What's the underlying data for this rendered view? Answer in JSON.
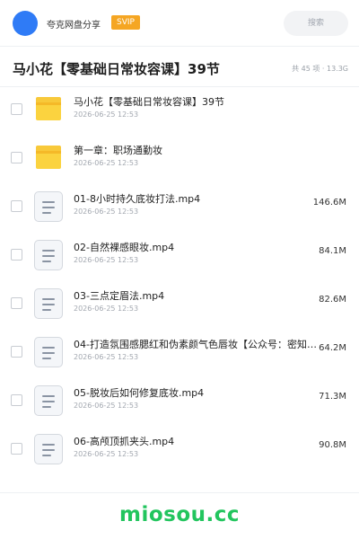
{
  "header": {
    "brand": "夸克网盘分享",
    "badge": "SVIP",
    "search_placeholder": "搜索"
  },
  "folder": {
    "title": "马小花【零基础日常妆容课】39节",
    "meta": "共 45 项 · 13.3G"
  },
  "items": [
    {
      "type": "folder",
      "name": "马小花【零基础日常妆容课】39节",
      "date": "2026-06-25 12:53",
      "size": ""
    },
    {
      "type": "folder",
      "name": "第一章：职场通勤妆",
      "date": "2026-06-25 12:53",
      "size": ""
    },
    {
      "type": "file",
      "name": "01-8小时持久底妆打法.mp4",
      "date": "2026-06-25 12:53",
      "size": "146.6M"
    },
    {
      "type": "file",
      "name": "02-自然裸感眼妆.mp4",
      "date": "2026-06-25 12:53",
      "size": "84.1M"
    },
    {
      "type": "file",
      "name": "03-三点定眉法.mp4",
      "date": "2026-06-25 12:53",
      "size": "82.6M"
    },
    {
      "type": "file",
      "name": "04-打造氛围感腮红和伪素颜气色唇妆【公众号：密知…",
      "date": "2026-06-25 12:53",
      "size": "64.2M"
    },
    {
      "type": "file",
      "name": "05-脱妆后如何修复底妆.mp4",
      "date": "2026-06-25 12:53",
      "size": "71.3M"
    },
    {
      "type": "file",
      "name": "06-高颅顶抓夹头.mp4",
      "date": "2026-06-25 12:53",
      "size": "90.8M"
    }
  ],
  "watermark": "miosou.cc",
  "colors": {
    "accent": "#2f7bf6",
    "svip": "#f5a623",
    "folder": "#fbd33f",
    "watermark": "#22c55e"
  }
}
